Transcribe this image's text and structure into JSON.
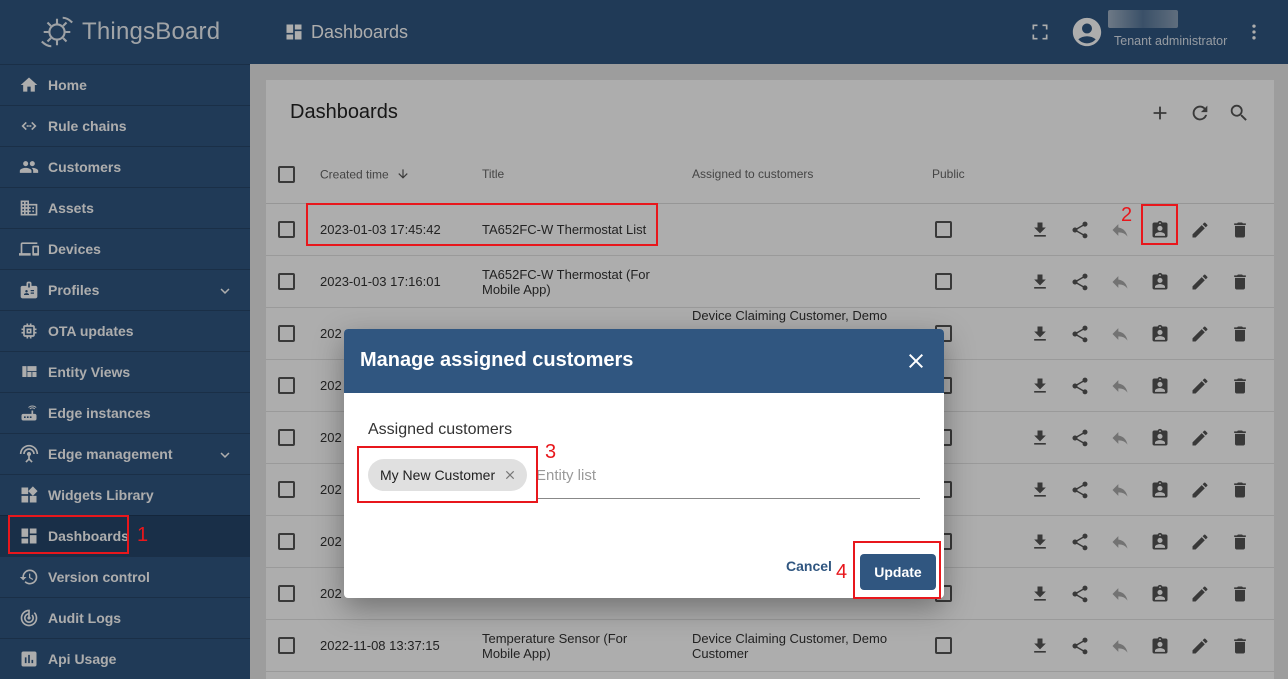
{
  "brand": {
    "name": "ThingsBoard"
  },
  "sidebar": {
    "items": [
      {
        "label": "Home",
        "icon": "home-icon"
      },
      {
        "label": "Rule chains",
        "icon": "code-arrows-icon"
      },
      {
        "label": "Customers",
        "icon": "people-icon"
      },
      {
        "label": "Assets",
        "icon": "building-icon"
      },
      {
        "label": "Devices",
        "icon": "devices-icon"
      },
      {
        "label": "Profiles",
        "icon": "badge-icon",
        "expandable": true
      },
      {
        "label": "OTA updates",
        "icon": "chip-icon"
      },
      {
        "label": "Entity Views",
        "icon": "view-quilt-icon"
      },
      {
        "label": "Edge instances",
        "icon": "router-icon"
      },
      {
        "label": "Edge management",
        "icon": "settings-input-antenna-icon",
        "expandable": true
      },
      {
        "label": "Widgets Library",
        "icon": "widgets-icon"
      },
      {
        "label": "Dashboards",
        "icon": "dashboard-icon",
        "active": true
      },
      {
        "label": "Version control",
        "icon": "history-icon"
      },
      {
        "label": "Audit Logs",
        "icon": "track-changes-icon"
      },
      {
        "label": "Api Usage",
        "icon": "insert-chart-icon"
      }
    ]
  },
  "topbar": {
    "title": "Dashboards",
    "user_role": "Tenant administrator"
  },
  "card": {
    "title": "Dashboards",
    "columns": {
      "created_time": "Created time",
      "title": "Title",
      "assigned": "Assigned to customers",
      "public": "Public"
    },
    "rows": [
      {
        "created": "2023-01-03 17:45:42",
        "title": "TA652FC-W Thermostat List",
        "assigned": ""
      },
      {
        "created": "2023-01-03 17:16:01",
        "title": "TA652FC-W Thermostat (For Mobile App)",
        "assigned": ""
      },
      {
        "created": "202",
        "title": "",
        "assigned": "Device Claiming Customer, Demo"
      },
      {
        "created": "202",
        "title": "",
        "assigned": ""
      },
      {
        "created": "202",
        "title": "",
        "assigned": ""
      },
      {
        "created": "202",
        "title": "",
        "assigned": ""
      },
      {
        "created": "202",
        "title": "",
        "assigned": ""
      },
      {
        "created": "202",
        "title": "",
        "assigned": ""
      },
      {
        "created": "2022-11-08 13:37:15",
        "title": "Temperature Sensor (For Mobile App)",
        "assigned": "Device Claiming Customer, Demo Customer"
      }
    ]
  },
  "dialog": {
    "title": "Manage assigned customers",
    "field_label": "Assigned customers",
    "chip": "My New Customer",
    "input_placeholder": "Entity list",
    "cancel_label": "Cancel",
    "update_label": "Update"
  },
  "annotations": [
    "1",
    "2",
    "3",
    "4"
  ],
  "colors": {
    "primary": "#305680",
    "annotation": "#e8171c"
  }
}
